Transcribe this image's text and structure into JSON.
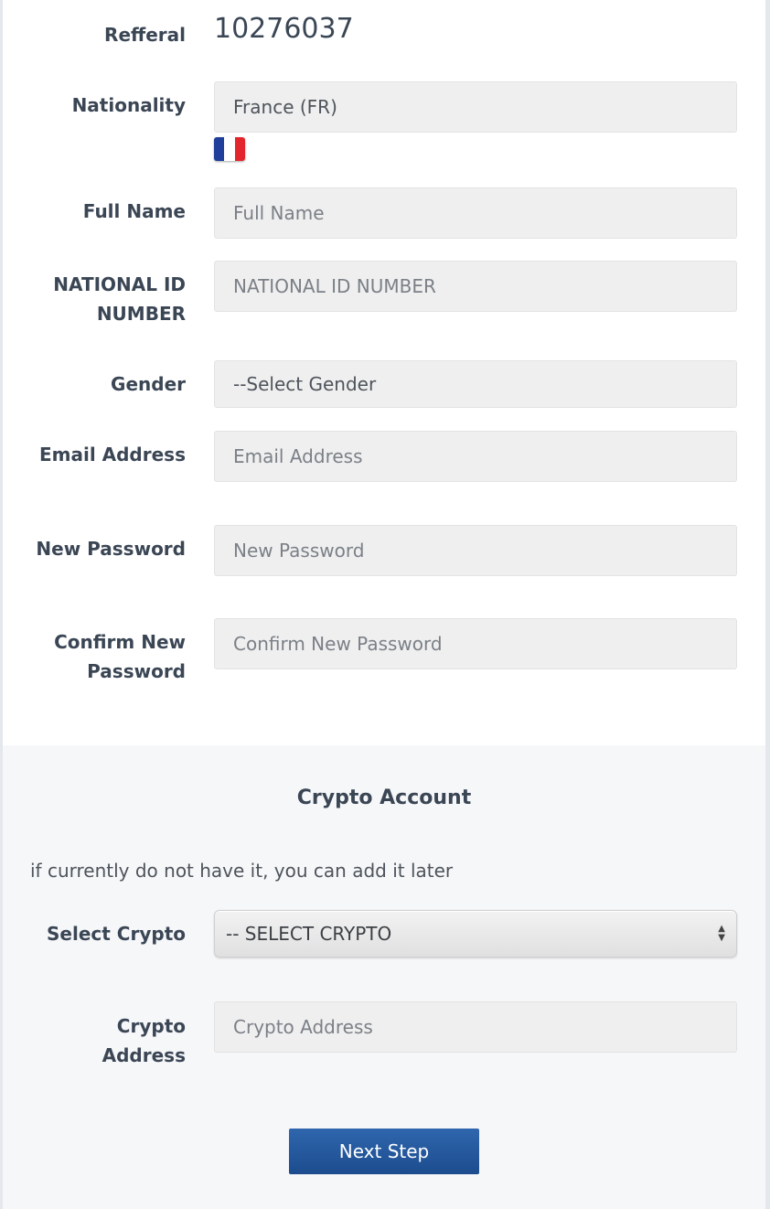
{
  "referral": {
    "label": "Refferal",
    "value": "10276037"
  },
  "nationality": {
    "label": "Nationality",
    "value": "France (FR)",
    "flag_icon": "france-flag-icon",
    "flag_colors": [
      "#1f3f9b",
      "#ffffff",
      "#e3262e"
    ]
  },
  "full_name": {
    "label": "Full Name",
    "placeholder": "Full Name"
  },
  "national_id": {
    "label_line1": "NATIONAL ID",
    "label_line2": "NUMBER",
    "placeholder": "NATIONAL ID NUMBER"
  },
  "gender": {
    "label": "Gender",
    "selected": "--Select Gender"
  },
  "email": {
    "label": "Email Address",
    "placeholder": "Email Address"
  },
  "new_password": {
    "label": "New Password",
    "placeholder": "New Password"
  },
  "confirm_password": {
    "label_line1": "Confirm New",
    "label_line2": "Password",
    "placeholder": "Confirm New Password"
  },
  "crypto_section": {
    "title": "Crypto Account",
    "note": "if currently do not have it, you can add it later",
    "select_label": "Select Crypto",
    "select_value": "-- SELECT CRYPTO",
    "address_label_line1": "Crypto",
    "address_label_line2": "Address",
    "address_placeholder": "Crypto Address"
  },
  "next_button": {
    "label": "Next Step",
    "color": "#1f4f92"
  }
}
